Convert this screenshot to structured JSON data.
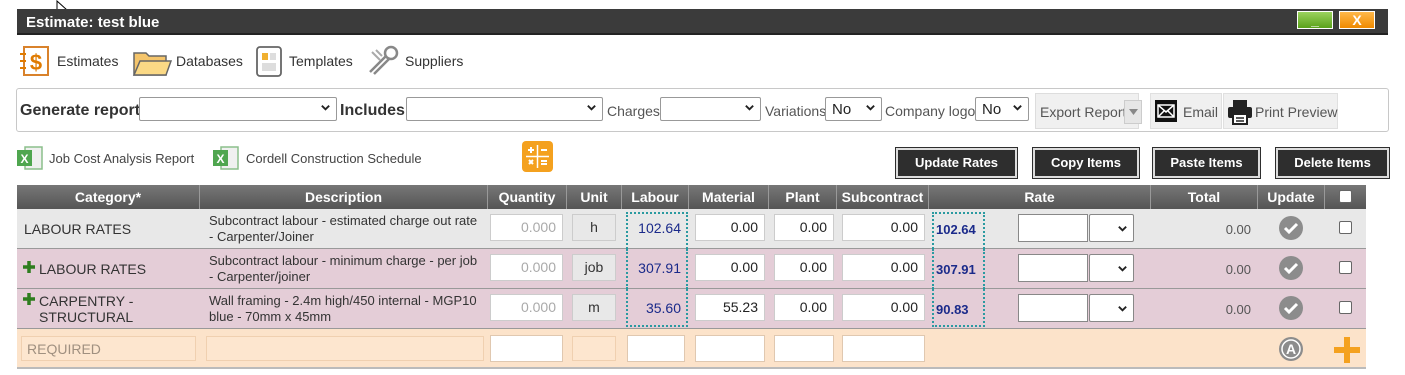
{
  "window": {
    "title": "Estimate: test blue",
    "minimize_label": "_",
    "close_label": "X"
  },
  "nav": [
    {
      "label": "Estimates",
      "icon": "estimates-icon"
    },
    {
      "label": "Databases",
      "icon": "folder-icon"
    },
    {
      "label": "Templates",
      "icon": "templates-icon"
    },
    {
      "label": "Suppliers",
      "icon": "suppliers-icon"
    }
  ],
  "report_bar": {
    "generate_label": "Generate report",
    "generate_value": "",
    "includes_label": "Includes",
    "includes_value": "",
    "charges_label": "Charges",
    "charges_value": "",
    "variations_label": "Variations",
    "variations_value": "No",
    "logo_label": "Company logo",
    "logo_value": "No",
    "export_label": "Export Report",
    "email_label": "Email",
    "print_label": "Print Preview"
  },
  "links": {
    "job_cost": "Job Cost Analysis Report",
    "cordell": "Cordell Construction Schedule"
  },
  "actions": {
    "update_rates": "Update Rates",
    "copy_items": "Copy Items",
    "paste_items": "Paste Items",
    "delete_items": "Delete Items"
  },
  "table": {
    "headers": {
      "category": "Category*",
      "description": "Description",
      "quantity": "Quantity",
      "unit": "Unit",
      "labour": "Labour",
      "material": "Material",
      "plant": "Plant",
      "subcontract": "Subcontract",
      "rate": "Rate",
      "total": "Total",
      "update": "Update"
    },
    "rows": [
      {
        "category": "LABOUR RATES",
        "description": "Subcontract labour - estimated charge out rate - Carpenter/Joiner",
        "quantity": "0.000",
        "unit": "h",
        "labour": "102.64",
        "material": "0.00",
        "plant": "0.00",
        "subcontract": "0.00",
        "rate": "102.64",
        "total": "0.00"
      },
      {
        "category": "LABOUR RATES",
        "description": "Subcontract labour - minimum charge - per job - Carpenter/joiner",
        "quantity": "0.000",
        "unit": "job",
        "labour": "307.91",
        "material": "0.00",
        "plant": "0.00",
        "subcontract": "0.00",
        "rate": "307.91",
        "total": "0.00"
      },
      {
        "category": "CARPENTRY - STRUCTURAL",
        "description": "Wall framing - 2.4m high/450 internal - MGP10 blue - 70mm x 45mm",
        "quantity": "0.000",
        "unit": "m",
        "labour": "35.60",
        "material": "55.23",
        "plant": "0.00",
        "subcontract": "0.00",
        "rate": "90.83",
        "total": "0.00"
      }
    ],
    "new_row": {
      "category_placeholder": "REQUIRED",
      "auto_label": "A"
    }
  },
  "colors": {
    "title_bar": "#3b3b3b",
    "row_even": "#e8e8e8",
    "row_pink": "#e4cdd7",
    "required_row": "#fce3ca",
    "accent_orange": "#f4a11f",
    "rate_blue": "#1a2a8a"
  }
}
